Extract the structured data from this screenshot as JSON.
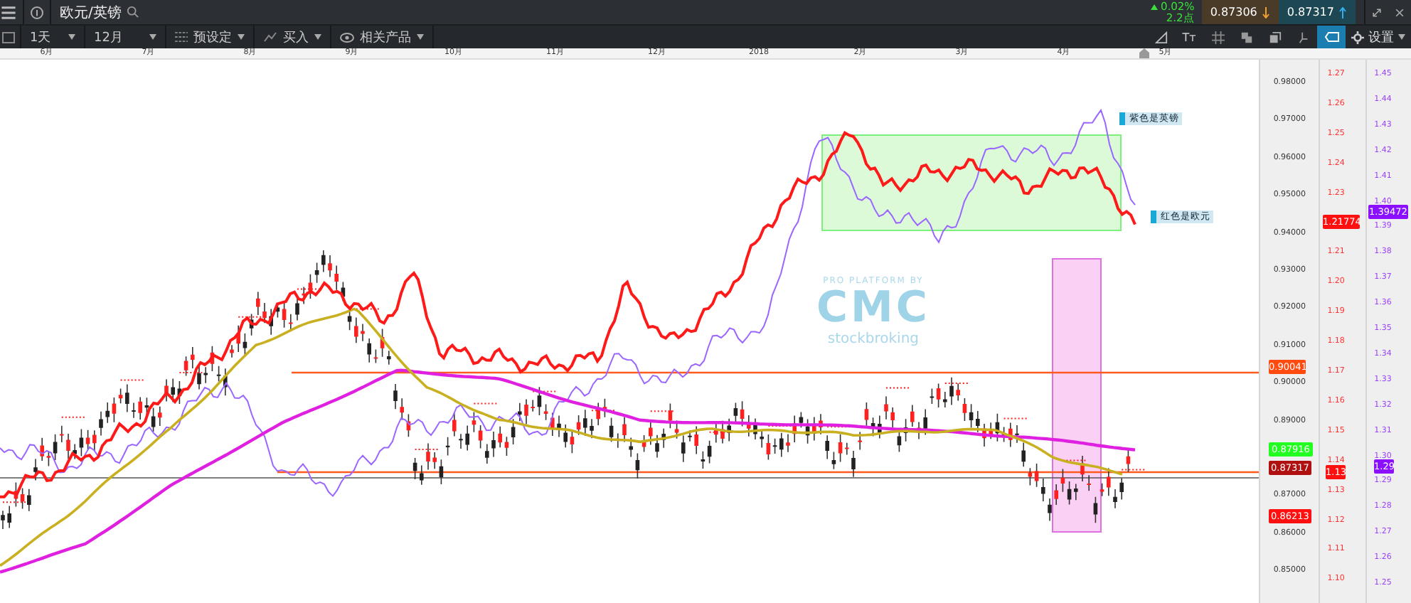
{
  "toolbar": {
    "title": "欧元/英镑",
    "period": "1天",
    "range": "12月",
    "presets": "预设定",
    "trade": "买入",
    "related": "相关产品",
    "change": "0.02%",
    "spread": "2.2点",
    "sell": "0.87306",
    "buy": "0.87317",
    "text_tool": "Tт",
    "settings": "设置"
  },
  "x_axis": [
    "6月",
    "7月",
    "8月",
    "9月",
    "10月",
    "11月",
    "12月",
    "2018",
    "2月",
    "3月",
    "4月",
    "5月"
  ],
  "axes": [
    {
      "color": "#333333",
      "ticks": [
        "0.98000",
        "0.97000",
        "0.96000",
        "0.95000",
        "0.94000",
        "0.93000",
        "0.92000",
        "0.91000",
        "0.90000",
        "0.89000",
        "0.87000",
        "0.86000",
        "0.85000"
      ]
    },
    {
      "color": "#ff3030",
      "ticks": [
        "1.27",
        "1.26",
        "1.25",
        "1.24",
        "1.23",
        "1.21",
        "1.20",
        "1.19",
        "1.18",
        "1.17",
        "1.16",
        "1.15",
        "1.14",
        "1.13",
        "1.12",
        "1.11",
        "1.10"
      ]
    },
    {
      "color": "#9a40ff",
      "ticks": [
        "1.45",
        "1.44",
        "1.43",
        "1.42",
        "1.41",
        "1.40",
        "1.39",
        "1.38",
        "1.37",
        "1.36",
        "1.35",
        "1.34",
        "1.33",
        "1.32",
        "1.31",
        "1.30",
        "1.29",
        "1.28",
        "1.27",
        "1.26",
        "1.25"
      ]
    }
  ],
  "price_tags": [
    {
      "text": "1.21774",
      "color": "#ff1010"
    },
    {
      "text": "1.39472",
      "color": "#8a10ff"
    },
    {
      "text": "0.90041",
      "color": "#ff4a10"
    },
    {
      "text": "0.87916",
      "color": "#20ff20"
    },
    {
      "text": "0.87317",
      "color": "#b01010"
    },
    {
      "text": "0.86213",
      "color": "#ff1010"
    },
    {
      "text": "1.13",
      "color": "#ff1010"
    },
    {
      "text": "1.29",
      "color": "#8a10ff"
    }
  ],
  "annotations": [
    "紫色是英镑",
    "红色是欧元"
  ],
  "watermark": {
    "top": "PRO PLATFORM BY",
    "logo": "CMC",
    "bottom": "stockbroking"
  }
}
